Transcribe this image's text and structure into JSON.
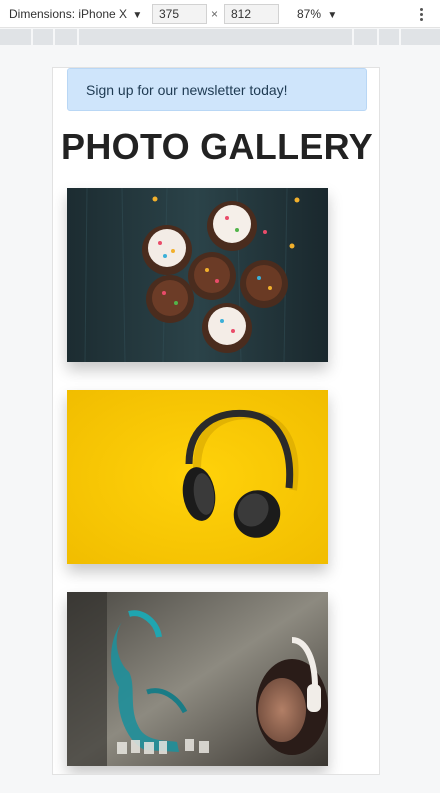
{
  "devtools": {
    "device_label": "Dimensions: iPhone X",
    "width": "375",
    "height": "812",
    "times": "×",
    "zoom": "87%",
    "dropdown_glyph": "▼"
  },
  "page": {
    "newsletter_text": "Sign up for our newsletter today!",
    "gallery_title": "PHOTO GALLERY"
  },
  "photos": [
    {
      "subject": "cupcakes"
    },
    {
      "subject": "headphones"
    },
    {
      "subject": "graffiti-wall"
    }
  ],
  "colors": {
    "newsletter_bg": "#cfe5fb",
    "headphones_bg": "#f7c600",
    "cupcake_bg": "#22343a"
  }
}
